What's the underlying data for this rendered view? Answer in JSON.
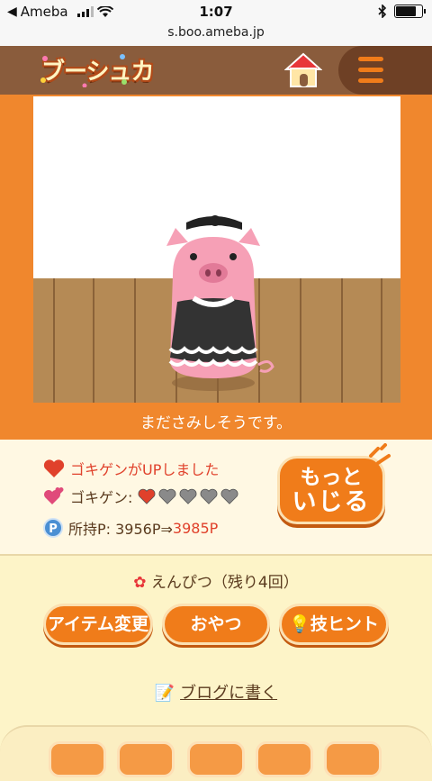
{
  "status_bar": {
    "back_app": "Ameba",
    "time": "1:07",
    "battery_level": 0.85
  },
  "browser": {
    "url": "s.boo.ameba.jp"
  },
  "header": {
    "logo_text": "ブーシュカ",
    "house_icon": "house-icon",
    "menu_icon": "hamburger-menu-icon"
  },
  "stage": {
    "caption": "まださみしそうです。"
  },
  "status_panel": {
    "mood_up_text": "ゴキゲンがUPしました",
    "mood_label": "ゴキゲン:",
    "mood_hearts_filled": 1,
    "mood_hearts_total": 5,
    "points_label": "所持P: 3956P⇒",
    "points_new": "3985P",
    "points_badge": "P",
    "play_button_line1": "もっと",
    "play_button_line2": "いじる"
  },
  "item_line": "えんぴつ（残り4回）",
  "actions": {
    "item_change": "アイテム変更",
    "snack": "おやつ",
    "hint": "技ヒント"
  },
  "blog_link": "ブログに書く",
  "colors": {
    "accent_orange": "#f07c1a",
    "header_brown": "#8a5c3c",
    "background_cream": "#fdf4c8",
    "heart_red": "#e0412b"
  }
}
